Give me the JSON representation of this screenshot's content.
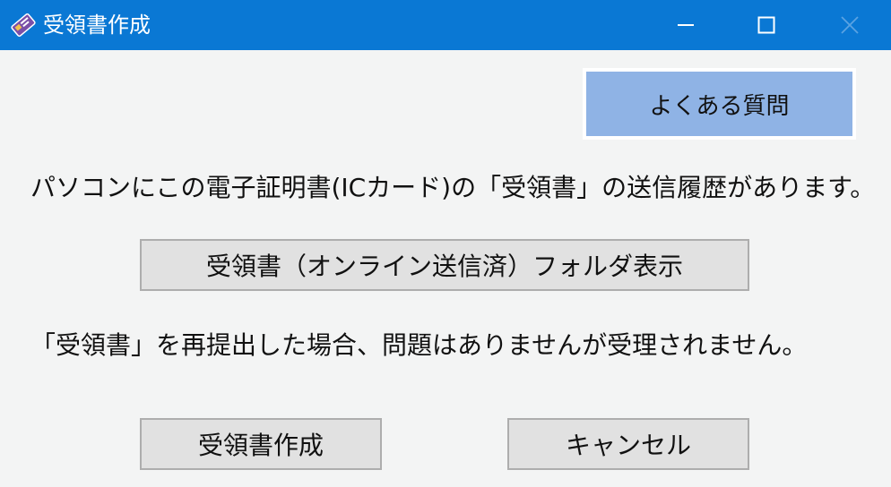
{
  "window": {
    "title": "受領書作成",
    "titlebar_color": "#0a78d4",
    "icon": "certificate-card-icon"
  },
  "controls": {
    "minimize_icon": "minimize-icon",
    "maximize_icon": "maximize-icon",
    "close_icon": "close-icon"
  },
  "buttons": {
    "faq": "よくある質問",
    "folder": "受領書（オンライン送信済）フォルダ表示",
    "create": "受領書作成",
    "cancel": "キャンセル"
  },
  "messages": {
    "history": "パソコンにこの電子証明書(ICカード)の「受領書」の送信履歴があります。",
    "warning": "「受領書」を再提出した場合、問題はありませんが受理されません。"
  },
  "colors": {
    "faq_button": "#8fb3e5",
    "button": "#e1e1e1",
    "background": "#f3f4f4"
  }
}
